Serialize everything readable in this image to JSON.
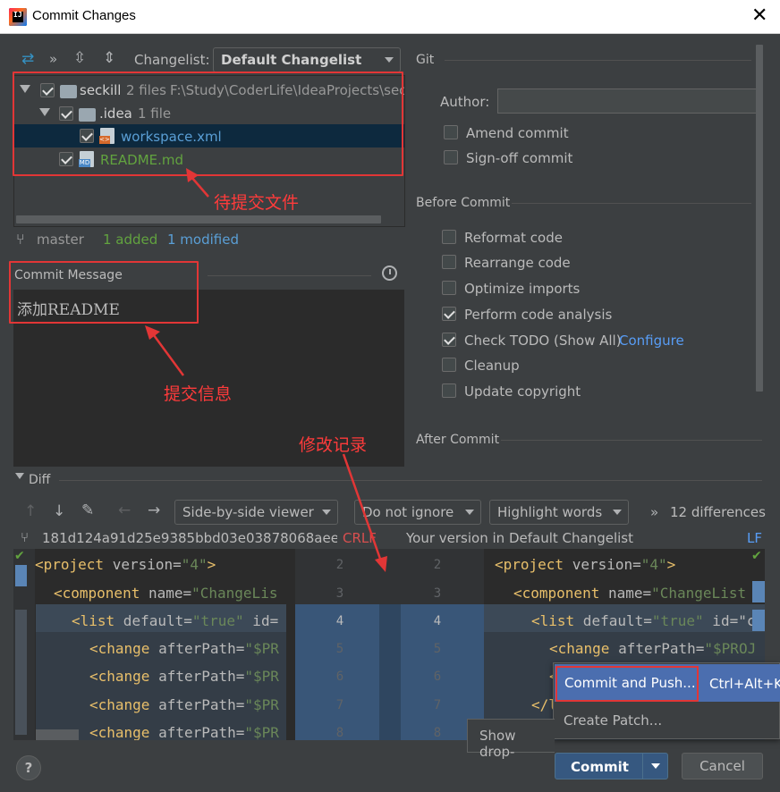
{
  "window": {
    "title": "Commit Changes",
    "close": "✕"
  },
  "changelist": {
    "label": "Changelist:",
    "value": "Default Changelist"
  },
  "tree": {
    "root_name": "seckill",
    "root_meta": "2 files",
    "root_path": "F:\\Study\\CoderLife\\IdeaProjects\\sec",
    "idea_name": ".idea",
    "idea_meta": "1 file",
    "file1": "workspace.xml",
    "file2": "README.md"
  },
  "branch": {
    "name": "master",
    "added": "1 added",
    "modified": "1 modified"
  },
  "annotations": {
    "pending_files": "待提交文件",
    "commit_info": "提交信息",
    "change_log": "修改记录"
  },
  "commit_message": {
    "label": "Commit Message",
    "text": "添加README"
  },
  "git": {
    "section": "Git",
    "author_label": "Author:",
    "author_value": "",
    "amend": "Amend commit",
    "signoff": "Sign-off commit"
  },
  "before_commit": {
    "section": "Before Commit",
    "items": [
      {
        "label": "Reformat code",
        "checked": false
      },
      {
        "label": "Rearrange code",
        "checked": false
      },
      {
        "label": "Optimize imports",
        "checked": false
      },
      {
        "label": "Perform code analysis",
        "checked": true
      },
      {
        "label": "Check TODO (Show All)",
        "checked": true
      },
      {
        "label": "Cleanup",
        "checked": false
      },
      {
        "label": "Update copyright",
        "checked": false
      }
    ],
    "configure": "Configure"
  },
  "after_commit": {
    "section": "After Commit"
  },
  "diff": {
    "label": "Diff",
    "viewer": "Side-by-side viewer",
    "ignore": "Do not ignore",
    "highlight": "Highlight words",
    "differences": "12 differences",
    "left_title": "181d124a91d25e9385bbd03e03878068aee...",
    "left_eol": "CRLF",
    "right_title": "Your version in Default Changelist",
    "right_eol": "LF",
    "left_lines": [
      {
        "tag": "<project",
        "rest": " version=",
        "val": "\"4\"",
        "end": ">"
      },
      {
        "tag": "<component",
        "rest": " name=",
        "val": "\"ChangeLis",
        "end": ""
      },
      {
        "tag": "<list",
        "rest": " default=",
        "val": "\"true\"",
        "end": " id="
      },
      {
        "tag": "<change",
        "rest": " afterPath=",
        "val": "\"$PR",
        "end": ""
      },
      {
        "tag": "<change",
        "rest": " afterPath=",
        "val": "\"$PR",
        "end": ""
      },
      {
        "tag": "<change",
        "rest": " afterPath=",
        "val": "\"$PR",
        "end": ""
      },
      {
        "tag": "<change",
        "rest": " afterPath=",
        "val": "\"$PR",
        "end": ""
      }
    ],
    "right_lines": [
      {
        "tag": "<project",
        "rest": " version=",
        "val": "\"4\"",
        "end": ">"
      },
      {
        "tag": "<component",
        "rest": " name=",
        "val": "\"ChangeList",
        "end": ""
      },
      {
        "tag": "<list",
        "rest": " default=",
        "val": "\"true\"",
        "end": " id=\"c"
      },
      {
        "tag": "<change",
        "rest": " afterPath=",
        "val": "\"$PROJ",
        "end": ""
      },
      {
        "tag": "<",
        "rest": "",
        "val": "",
        "end": ""
      },
      {
        "tag": "</l",
        "rest": "",
        "val": "",
        "end": ""
      }
    ],
    "gutter_left": [
      "2",
      "3",
      "4",
      "5",
      "6",
      "7",
      "8"
    ],
    "gutter_right": [
      "2",
      "3",
      "4",
      "5",
      "6",
      "7",
      "8"
    ]
  },
  "popup": {
    "commit_push": "Commit and Push...",
    "shortcut": "Ctrl+Alt+K",
    "create_patch": "Create Patch..."
  },
  "tooltip": "Show drop-",
  "buttons": {
    "help": "?",
    "commit": "Commit",
    "cancel": "Cancel"
  }
}
